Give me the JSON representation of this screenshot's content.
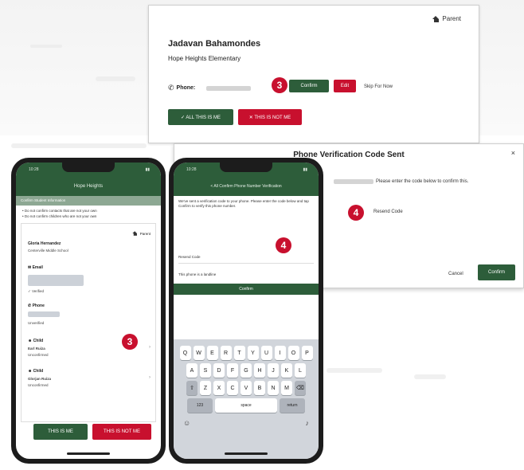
{
  "desktop": {
    "parent_label": "Parent",
    "name": "Jadavan Bahamondes",
    "school": "Hope Heights Elementary",
    "phone_label": "Phone:",
    "phone_confirm_btn": "Confirm",
    "phone_edit_btn": "Edit",
    "skip_label": "Skip For Now",
    "step3_badge": "3",
    "confirm_all_btn": "✓ ALL THIS IS ME",
    "not_me_btn": "✕ THIS IS NOT ME"
  },
  "modal": {
    "title": "Phone Verification Code Sent",
    "close_glyph": "×",
    "instruction": "Please enter the code below to confirm this.",
    "step4_badge": "4",
    "field_label": "Resend Code",
    "cancel_label": "Cancel",
    "confirm_label": "Confirm"
  },
  "phone1": {
    "time": "10:28",
    "app_title": "Hope Heights",
    "banner": "Confirm Student Information",
    "warn1": "• Do not confirm contacts that are not your own",
    "warn2": "• Do not confirm children who are not your own",
    "parent_label": "Parent",
    "name": "Gloria Hernandez",
    "school": "Centerville Middle School",
    "email_label": "Email",
    "verified": "✓ Verified",
    "phone_label": "Phone",
    "unverified": "Unverified",
    "child1_label": "Child",
    "child1_name": "Earl Ruiza",
    "child1_status": "Unconfirmed",
    "child2_label": "Child",
    "child2_name": "Glorjan Ruiza",
    "child2_status": "Unconfirmed",
    "step3_badge": "3",
    "this_is_me_btn": "THIS IS ME",
    "not_me_btn": "THIS IS NOT ME"
  },
  "phone2": {
    "time": "10:28",
    "title": "< All Confirm Phone Number Verification",
    "message": "We've sent a verification code to your phone. Please enter the code below and tap Confirm to verify this phone number.",
    "step4_badge": "4",
    "field_label": "Resend Code",
    "landline_label": "This phone is a landline",
    "confirm_btn": "Confirm",
    "kb_row1": [
      "Q",
      "W",
      "E",
      "R",
      "T",
      "Y",
      "U",
      "I",
      "O",
      "P"
    ],
    "kb_row2": [
      "A",
      "S",
      "D",
      "F",
      "G",
      "H",
      "J",
      "K",
      "L"
    ],
    "kb_row3": [
      "Z",
      "X",
      "C",
      "V",
      "B",
      "N",
      "M"
    ],
    "kb_shift": "⇧",
    "kb_delete": "⌫",
    "kb_123": "123",
    "kb_space": "space",
    "kb_return": "return",
    "kb_emoji": "☺",
    "kb_mic": "♪"
  },
  "colors": {
    "brand_green": "#2d5d3a",
    "accent_red": "#c8102e"
  }
}
